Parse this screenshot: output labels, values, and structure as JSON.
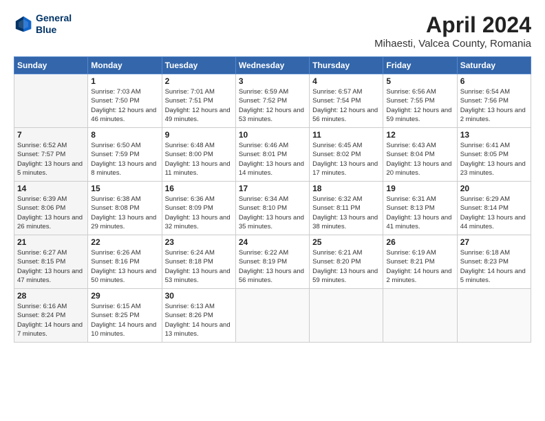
{
  "header": {
    "logo_line1": "General",
    "logo_line2": "Blue",
    "month": "April 2024",
    "location": "Mihaesti, Valcea County, Romania"
  },
  "weekdays": [
    "Sunday",
    "Monday",
    "Tuesday",
    "Wednesday",
    "Thursday",
    "Friday",
    "Saturday"
  ],
  "weeks": [
    [
      {
        "day": "",
        "sunrise": "",
        "sunset": "",
        "daylight": ""
      },
      {
        "day": "1",
        "sunrise": "Sunrise: 7:03 AM",
        "sunset": "Sunset: 7:50 PM",
        "daylight": "Daylight: 12 hours and 46 minutes."
      },
      {
        "day": "2",
        "sunrise": "Sunrise: 7:01 AM",
        "sunset": "Sunset: 7:51 PM",
        "daylight": "Daylight: 12 hours and 49 minutes."
      },
      {
        "day": "3",
        "sunrise": "Sunrise: 6:59 AM",
        "sunset": "Sunset: 7:52 PM",
        "daylight": "Daylight: 12 hours and 53 minutes."
      },
      {
        "day": "4",
        "sunrise": "Sunrise: 6:57 AM",
        "sunset": "Sunset: 7:54 PM",
        "daylight": "Daylight: 12 hours and 56 minutes."
      },
      {
        "day": "5",
        "sunrise": "Sunrise: 6:56 AM",
        "sunset": "Sunset: 7:55 PM",
        "daylight": "Daylight: 12 hours and 59 minutes."
      },
      {
        "day": "6",
        "sunrise": "Sunrise: 6:54 AM",
        "sunset": "Sunset: 7:56 PM",
        "daylight": "Daylight: 13 hours and 2 minutes."
      }
    ],
    [
      {
        "day": "7",
        "sunrise": "Sunrise: 6:52 AM",
        "sunset": "Sunset: 7:57 PM",
        "daylight": "Daylight: 13 hours and 5 minutes."
      },
      {
        "day": "8",
        "sunrise": "Sunrise: 6:50 AM",
        "sunset": "Sunset: 7:59 PM",
        "daylight": "Daylight: 13 hours and 8 minutes."
      },
      {
        "day": "9",
        "sunrise": "Sunrise: 6:48 AM",
        "sunset": "Sunset: 8:00 PM",
        "daylight": "Daylight: 13 hours and 11 minutes."
      },
      {
        "day": "10",
        "sunrise": "Sunrise: 6:46 AM",
        "sunset": "Sunset: 8:01 PM",
        "daylight": "Daylight: 13 hours and 14 minutes."
      },
      {
        "day": "11",
        "sunrise": "Sunrise: 6:45 AM",
        "sunset": "Sunset: 8:02 PM",
        "daylight": "Daylight: 13 hours and 17 minutes."
      },
      {
        "day": "12",
        "sunrise": "Sunrise: 6:43 AM",
        "sunset": "Sunset: 8:04 PM",
        "daylight": "Daylight: 13 hours and 20 minutes."
      },
      {
        "day": "13",
        "sunrise": "Sunrise: 6:41 AM",
        "sunset": "Sunset: 8:05 PM",
        "daylight": "Daylight: 13 hours and 23 minutes."
      }
    ],
    [
      {
        "day": "14",
        "sunrise": "Sunrise: 6:39 AM",
        "sunset": "Sunset: 8:06 PM",
        "daylight": "Daylight: 13 hours and 26 minutes."
      },
      {
        "day": "15",
        "sunrise": "Sunrise: 6:38 AM",
        "sunset": "Sunset: 8:08 PM",
        "daylight": "Daylight: 13 hours and 29 minutes."
      },
      {
        "day": "16",
        "sunrise": "Sunrise: 6:36 AM",
        "sunset": "Sunset: 8:09 PM",
        "daylight": "Daylight: 13 hours and 32 minutes."
      },
      {
        "day": "17",
        "sunrise": "Sunrise: 6:34 AM",
        "sunset": "Sunset: 8:10 PM",
        "daylight": "Daylight: 13 hours and 35 minutes."
      },
      {
        "day": "18",
        "sunrise": "Sunrise: 6:32 AM",
        "sunset": "Sunset: 8:11 PM",
        "daylight": "Daylight: 13 hours and 38 minutes."
      },
      {
        "day": "19",
        "sunrise": "Sunrise: 6:31 AM",
        "sunset": "Sunset: 8:13 PM",
        "daylight": "Daylight: 13 hours and 41 minutes."
      },
      {
        "day": "20",
        "sunrise": "Sunrise: 6:29 AM",
        "sunset": "Sunset: 8:14 PM",
        "daylight": "Daylight: 13 hours and 44 minutes."
      }
    ],
    [
      {
        "day": "21",
        "sunrise": "Sunrise: 6:27 AM",
        "sunset": "Sunset: 8:15 PM",
        "daylight": "Daylight: 13 hours and 47 minutes."
      },
      {
        "day": "22",
        "sunrise": "Sunrise: 6:26 AM",
        "sunset": "Sunset: 8:16 PM",
        "daylight": "Daylight: 13 hours and 50 minutes."
      },
      {
        "day": "23",
        "sunrise": "Sunrise: 6:24 AM",
        "sunset": "Sunset: 8:18 PM",
        "daylight": "Daylight: 13 hours and 53 minutes."
      },
      {
        "day": "24",
        "sunrise": "Sunrise: 6:22 AM",
        "sunset": "Sunset: 8:19 PM",
        "daylight": "Daylight: 13 hours and 56 minutes."
      },
      {
        "day": "25",
        "sunrise": "Sunrise: 6:21 AM",
        "sunset": "Sunset: 8:20 PM",
        "daylight": "Daylight: 13 hours and 59 minutes."
      },
      {
        "day": "26",
        "sunrise": "Sunrise: 6:19 AM",
        "sunset": "Sunset: 8:21 PM",
        "daylight": "Daylight: 14 hours and 2 minutes."
      },
      {
        "day": "27",
        "sunrise": "Sunrise: 6:18 AM",
        "sunset": "Sunset: 8:23 PM",
        "daylight": "Daylight: 14 hours and 5 minutes."
      }
    ],
    [
      {
        "day": "28",
        "sunrise": "Sunrise: 6:16 AM",
        "sunset": "Sunset: 8:24 PM",
        "daylight": "Daylight: 14 hours and 7 minutes."
      },
      {
        "day": "29",
        "sunrise": "Sunrise: 6:15 AM",
        "sunset": "Sunset: 8:25 PM",
        "daylight": "Daylight: 14 hours and 10 minutes."
      },
      {
        "day": "30",
        "sunrise": "Sunrise: 6:13 AM",
        "sunset": "Sunset: 8:26 PM",
        "daylight": "Daylight: 14 hours and 13 minutes."
      },
      {
        "day": "",
        "sunrise": "",
        "sunset": "",
        "daylight": ""
      },
      {
        "day": "",
        "sunrise": "",
        "sunset": "",
        "daylight": ""
      },
      {
        "day": "",
        "sunrise": "",
        "sunset": "",
        "daylight": ""
      },
      {
        "day": "",
        "sunrise": "",
        "sunset": "",
        "daylight": ""
      }
    ]
  ]
}
